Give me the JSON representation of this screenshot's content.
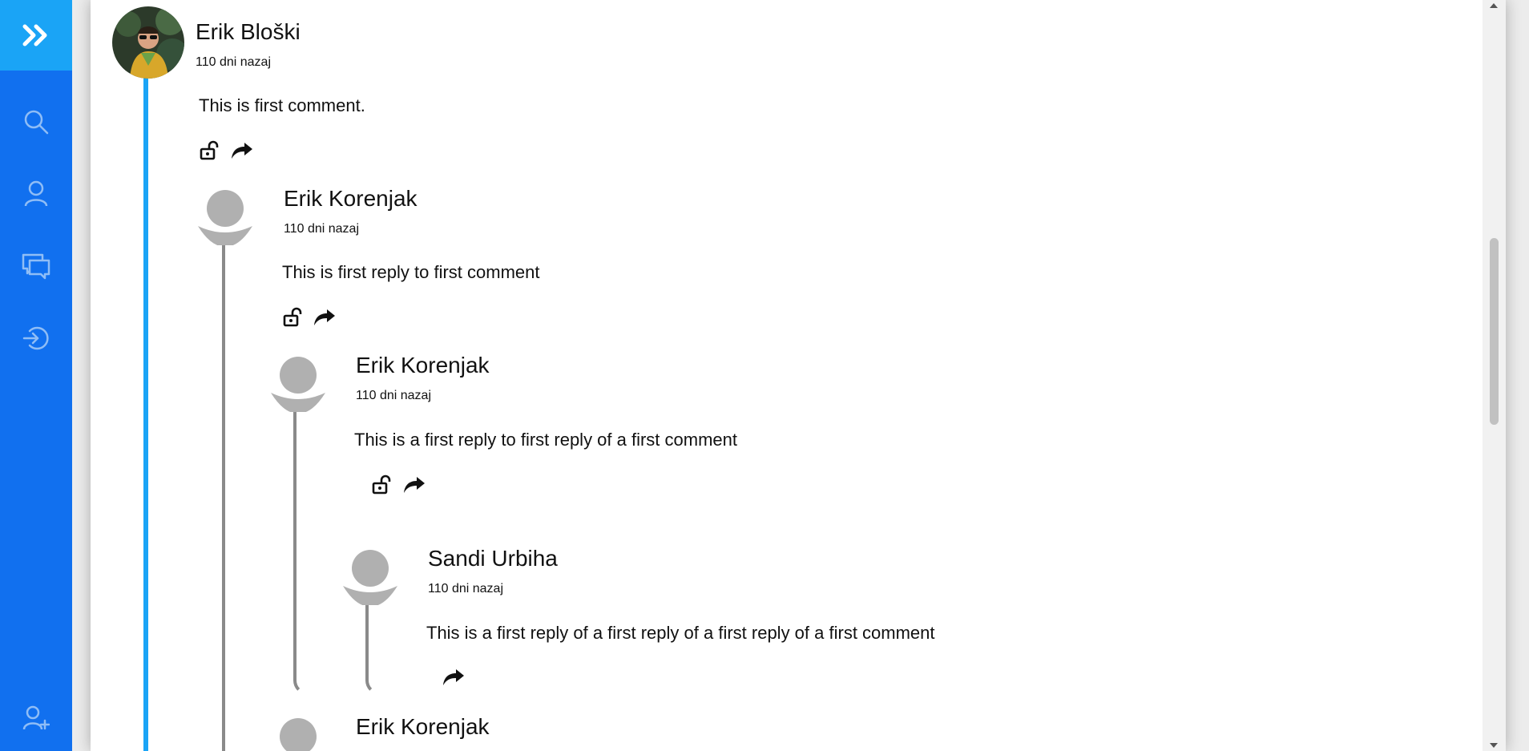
{
  "sidebar": {
    "toggle_icon": "double-chevron-right-icon",
    "items": [
      {
        "icon": "search-icon"
      },
      {
        "icon": "user-icon"
      },
      {
        "icon": "chat-icon"
      },
      {
        "icon": "login-icon"
      },
      {
        "icon": "add-user-icon"
      }
    ],
    "accent": "#1aa4f6",
    "background": "#1170ef"
  },
  "comments": [
    {
      "author": "Erik Bloški",
      "time": "110 dni nazaj",
      "text": "This is first comment."
    },
    {
      "author": "Erik Korenjak",
      "time": "110 dni nazaj",
      "text": "This is first reply to first comment"
    },
    {
      "author": "Erik Korenjak",
      "time": "110 dni nazaj",
      "text": "This is a first reply to first reply of a first comment"
    },
    {
      "author": "Sandi Urbiha",
      "time": "110 dni nazaj",
      "text": "This is a first reply of a first reply of a first reply of a first comment"
    },
    {
      "author": "Erik Korenjak"
    }
  ]
}
